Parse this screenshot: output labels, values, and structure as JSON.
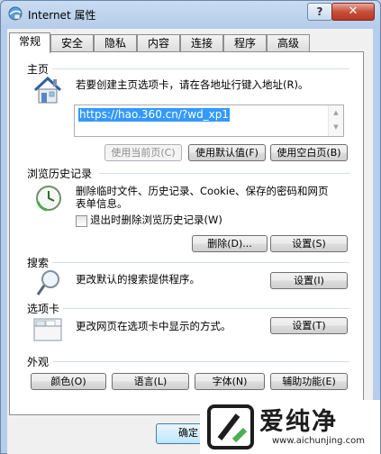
{
  "window": {
    "title": "Internet 属性",
    "help_label": "?",
    "close_label": "✕"
  },
  "tabs": [
    "常规",
    "安全",
    "隐私",
    "内容",
    "连接",
    "程序",
    "高级"
  ],
  "home": {
    "group_label": "主页",
    "description": "若要创建主页选项卡，请在各地址行键入地址(R)。",
    "url": "https://hao.360.cn/?wd_xp1",
    "btn_current": "使用当前页(C)",
    "btn_default": "使用默认值(F)",
    "btn_blank": "使用空白页(B)"
  },
  "history": {
    "group_label": "浏览历史记录",
    "description_line1": "删除临时文件、历史记录、Cookie、保存的密码和网页",
    "description_line2": "表单信息。",
    "checkbox_label": "退出时删除浏览历史记录(W)",
    "btn_delete": "删除(D)...",
    "btn_settings": "设置(S)"
  },
  "search": {
    "group_label": "搜索",
    "description": "更改默认的搜索提供程序。",
    "btn_settings": "设置(I)"
  },
  "tabs_section": {
    "group_label": "选项卡",
    "description": "更改网页在选项卡中显示的方式。",
    "btn_settings": "设置(T)"
  },
  "appearance": {
    "group_label": "外观",
    "btn_colors": "颜色(O)",
    "btn_languages": "语言(L)",
    "btn_fonts": "字体(N)",
    "btn_accessibility": "辅助功能(E)"
  },
  "footer": {
    "ok_label": "确定"
  },
  "watermark": {
    "text": "爱纯净",
    "url": "www.aichunjing.com"
  }
}
